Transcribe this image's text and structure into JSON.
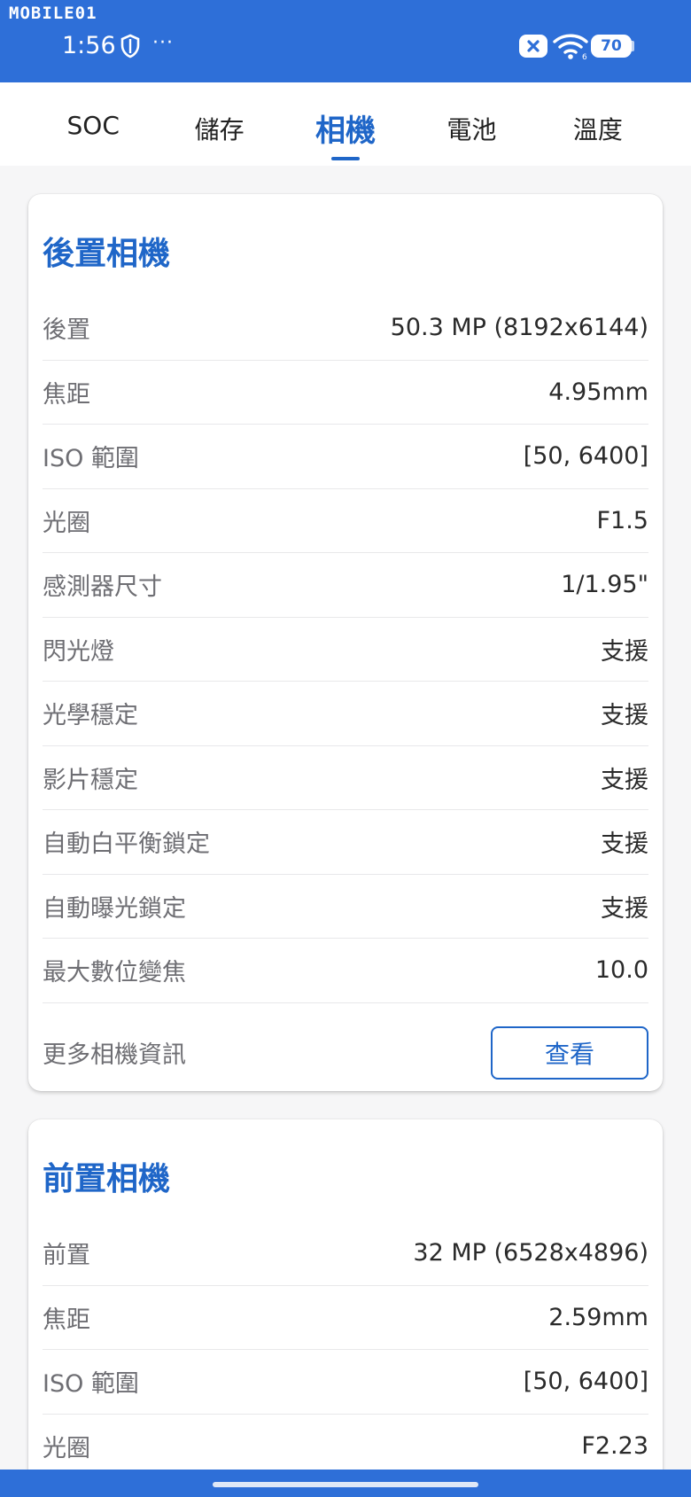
{
  "status_bar": {
    "watermark": "MOBILE01",
    "time": "1:56",
    "more": "···",
    "battery": "70",
    "wifi_badge": "6"
  },
  "tabs": [
    {
      "label": "SOC",
      "active": false
    },
    {
      "label": "儲存",
      "active": false
    },
    {
      "label": "相機",
      "active": true
    },
    {
      "label": "電池",
      "active": false
    },
    {
      "label": "溫度",
      "active": false
    }
  ],
  "rear_camera": {
    "title": "後置相機",
    "rows": [
      {
        "label": "後置",
        "value": "50.3 MP (8192x6144)"
      },
      {
        "label": "焦距",
        "value": "4.95mm"
      },
      {
        "label": "ISO 範圍",
        "value": "[50, 6400]"
      },
      {
        "label": "光圈",
        "value": "F1.5"
      },
      {
        "label": "感測器尺寸",
        "value": "1/1.95\""
      },
      {
        "label": "閃光燈",
        "value": "支援"
      },
      {
        "label": "光學穩定",
        "value": "支援"
      },
      {
        "label": "影片穩定",
        "value": "支援"
      },
      {
        "label": "自動白平衡鎖定",
        "value": "支援"
      },
      {
        "label": "自動曝光鎖定",
        "value": "支援"
      },
      {
        "label": "最大數位變焦",
        "value": "10.0"
      }
    ],
    "more_label": "更多相機資訊",
    "view_button": "查看"
  },
  "front_camera": {
    "title": "前置相機",
    "rows": [
      {
        "label": "前置",
        "value": "32 MP (6528x4896)"
      },
      {
        "label": "焦距",
        "value": "2.59mm"
      },
      {
        "label": "ISO 範圍",
        "value": "[50, 6400]"
      },
      {
        "label": "光圈",
        "value": "F2.23"
      }
    ]
  },
  "colors": {
    "accent": "#1f66c8",
    "status_bar": "#2e6fd8",
    "background": "#f6f6f7"
  }
}
